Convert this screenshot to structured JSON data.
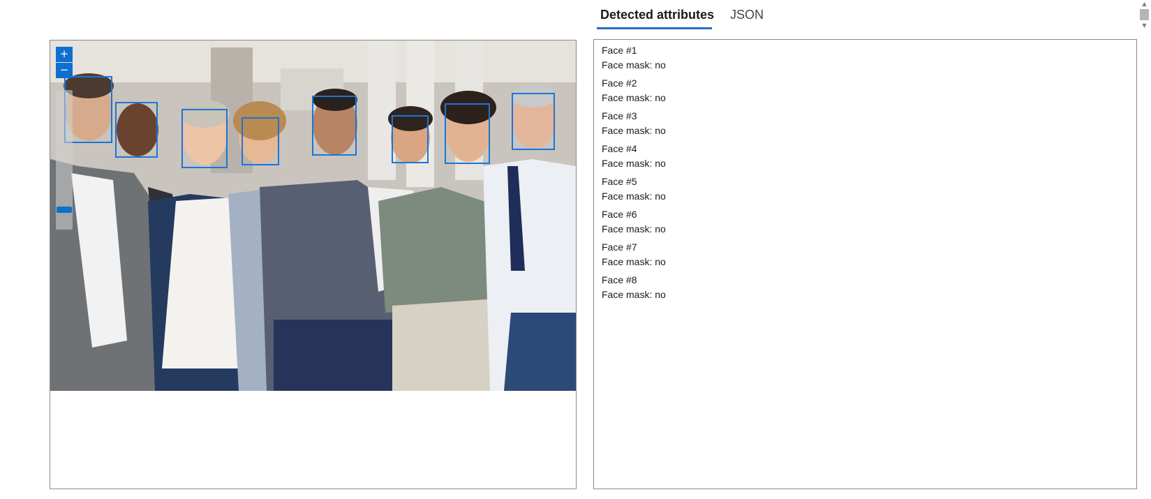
{
  "tabs": [
    {
      "label": "Detected attributes",
      "active": true
    },
    {
      "label": "JSON",
      "active": false
    }
  ],
  "viewer": {
    "zoom_in_icon": "plus-icon",
    "zoom_out_icon": "minus-icon",
    "zoom_in_label": "+",
    "zoom_out_label": "−"
  },
  "faces": [
    {
      "title": "Face #1",
      "mask": "Face mask: no"
    },
    {
      "title": "Face #2",
      "mask": "Face mask: no"
    },
    {
      "title": "Face #3",
      "mask": "Face mask: no"
    },
    {
      "title": "Face #4",
      "mask": "Face mask: no"
    },
    {
      "title": "Face #5",
      "mask": "Face mask: no"
    },
    {
      "title": "Face #6",
      "mask": "Face mask: no"
    },
    {
      "title": "Face #7",
      "mask": "Face mask: no"
    },
    {
      "title": "Face #8",
      "mask": "Face mask: no"
    }
  ],
  "scrollbar": {
    "up_icon": "chevron-up-icon",
    "down_icon": "chevron-down-icon"
  },
  "colors": {
    "accent": "#1f70c8",
    "face_box": "#1b74d8",
    "border": "#8a8a8a"
  }
}
